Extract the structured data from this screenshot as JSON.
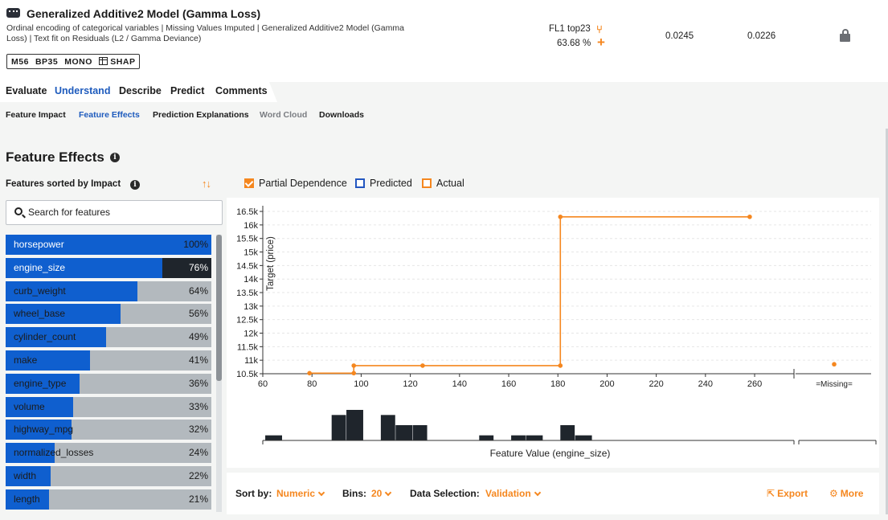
{
  "model": {
    "title": "Generalized Additive2 Model (Gamma Loss)",
    "description": "Ordinal encoding of categorical variables | Missing Values Imputed | Generalized Additive2 Model (Gamma Loss) | Text fit on Residuals (L2 / Gamma Deviance)",
    "tags": [
      "M56",
      "BP35",
      "MONO",
      "SHAP"
    ],
    "leaderboard": "FL1 top23",
    "sample_pct": "63.68 %",
    "metric_validation": "0.0245",
    "metric_cv": "0.0226"
  },
  "nav": {
    "tabs": [
      "Evaluate",
      "Understand",
      "Describe",
      "Predict",
      "Comments"
    ],
    "active_tab": "Understand",
    "subtabs": [
      "Feature Impact",
      "Feature Effects",
      "Prediction Explanations",
      "Word Cloud",
      "Downloads"
    ],
    "active_subtab": "Feature Effects"
  },
  "panel": {
    "title": "Feature Effects",
    "sorted_label": "Features sorted by Impact",
    "search_placeholder": "Search for features"
  },
  "features": [
    {
      "name": "horsepower",
      "impact": "100%",
      "fraction": 1.0
    },
    {
      "name": "engine_size",
      "impact": "76%",
      "fraction": 0.76,
      "selected": true
    },
    {
      "name": "curb_weight",
      "impact": "64%",
      "fraction": 0.64
    },
    {
      "name": "wheel_base",
      "impact": "56%",
      "fraction": 0.56
    },
    {
      "name": "cylinder_count",
      "impact": "49%",
      "fraction": 0.49
    },
    {
      "name": "make",
      "impact": "41%",
      "fraction": 0.41
    },
    {
      "name": "engine_type",
      "impact": "36%",
      "fraction": 0.36
    },
    {
      "name": "volume",
      "impact": "33%",
      "fraction": 0.33
    },
    {
      "name": "highway_mpg",
      "impact": "32%",
      "fraction": 0.32
    },
    {
      "name": "normalized_losses",
      "impact": "24%",
      "fraction": 0.24
    },
    {
      "name": "width",
      "impact": "22%",
      "fraction": 0.22
    },
    {
      "name": "length",
      "impact": "21%",
      "fraction": 0.21
    }
  ],
  "legend": {
    "partial_dependence": "Partial Dependence",
    "predicted": "Predicted",
    "actual": "Actual"
  },
  "colors": {
    "accent": "#f5871f",
    "blue": "#0f5fcf",
    "link": "#1e5bbd",
    "dark": "#1f252c"
  },
  "chart_data": {
    "type": "line",
    "ylabel": "Target (price)",
    "xlabel": "Feature Value (engine_size)",
    "y_ticks": [
      "16.5k",
      "16k",
      "15.5k",
      "15k",
      "14.5k",
      "14k",
      "13.5k",
      "13k",
      "12.5k",
      "12k",
      "11.5k",
      "11k",
      "10.5k"
    ],
    "y_tick_values": [
      16500,
      16000,
      15500,
      15000,
      14500,
      14000,
      13500,
      13000,
      12500,
      12000,
      11500,
      11000,
      10500
    ],
    "x_ticks": [
      "60",
      "80",
      "100",
      "120",
      "140",
      "160",
      "180",
      "200",
      "220",
      "240",
      "260"
    ],
    "x_tick_values": [
      60,
      80,
      100,
      120,
      140,
      160,
      180,
      200,
      220,
      240,
      260
    ],
    "xlim": [
      60,
      276
    ],
    "ylim": [
      10500,
      16650
    ],
    "missing_label": "=Missing=",
    "partial_dependence": [
      {
        "x": 79,
        "y": 10520
      },
      {
        "x": 97,
        "y": 10520
      },
      {
        "x": 97,
        "y": 10800
      },
      {
        "x": 125,
        "y": 10800
      },
      {
        "x": 181,
        "y": 10800
      },
      {
        "x": 181,
        "y": 16300
      },
      {
        "x": 258,
        "y": 16300
      }
    ],
    "points": [
      {
        "x": 79,
        "y": 10520
      },
      {
        "x": 97,
        "y": 10520
      },
      {
        "x": 97,
        "y": 10800
      },
      {
        "x": 125,
        "y": 10800
      },
      {
        "x": 181,
        "y": 10800
      },
      {
        "x": 181,
        "y": 16300
      },
      {
        "x": 258,
        "y": 16300
      }
    ],
    "missing_value": 10850,
    "histogram": [
      {
        "x_start": 61,
        "x_end": 68,
        "count": 1
      },
      {
        "x_start": 88,
        "x_end": 94,
        "count": 5
      },
      {
        "x_start": 94,
        "x_end": 101,
        "count": 6
      },
      {
        "x_start": 108,
        "x_end": 114,
        "count": 5
      },
      {
        "x_start": 114,
        "x_end": 121,
        "count": 3
      },
      {
        "x_start": 121,
        "x_end": 127,
        "count": 3
      },
      {
        "x_start": 148,
        "x_end": 154,
        "count": 1
      },
      {
        "x_start": 161,
        "x_end": 167,
        "count": 1
      },
      {
        "x_start": 167,
        "x_end": 174,
        "count": 1
      },
      {
        "x_start": 181,
        "x_end": 187,
        "count": 3
      },
      {
        "x_start": 187,
        "x_end": 194,
        "count": 1
      }
    ]
  },
  "controls": {
    "sort_label": "Sort by:",
    "sort_value": "Numeric",
    "bins_label": "Bins:",
    "bins_value": "20",
    "selection_label": "Data Selection:",
    "selection_value": "Validation",
    "export": "Export",
    "more": "More"
  }
}
